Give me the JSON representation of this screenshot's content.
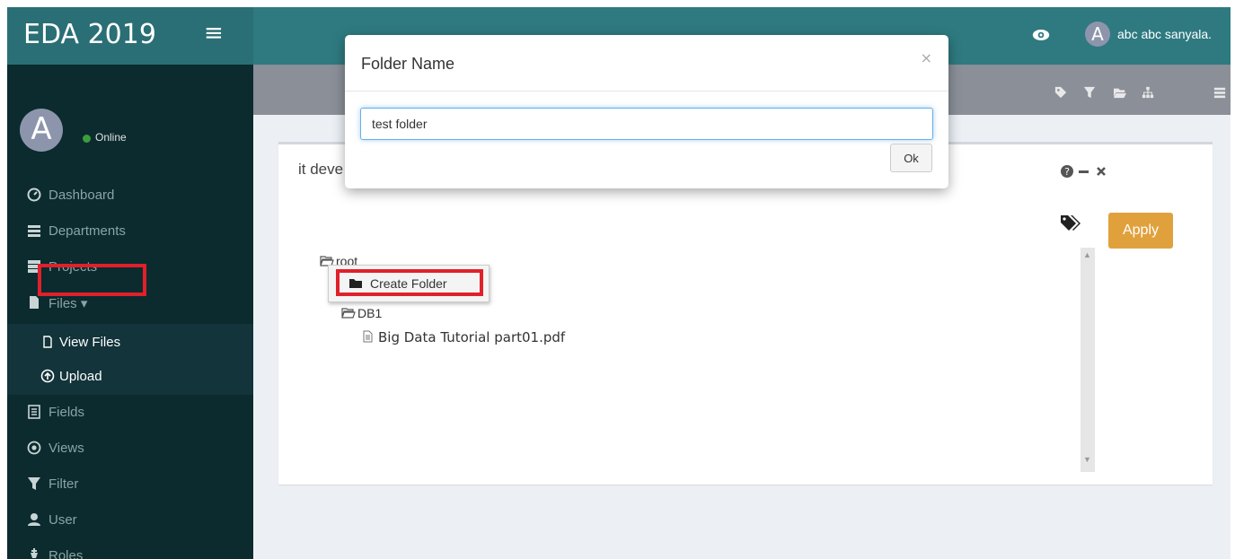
{
  "header": {
    "brand": "EDA 2019",
    "menu_icon": "hamburger-icon",
    "user_avatar_letter": "A",
    "user_name": "abc abc sanyala."
  },
  "sidebar": {
    "avatar_letter": "A",
    "status": "Online",
    "items": [
      {
        "label": "Dashboard",
        "icon": "dashboard-icon"
      },
      {
        "label": "Departments",
        "icon": "list-icon"
      },
      {
        "label": "Projects",
        "icon": "server-icon"
      },
      {
        "label": "Files ▾",
        "icon": "file-icon"
      },
      {
        "label": "View Files",
        "icon": "file-outline-icon"
      },
      {
        "label": "Upload",
        "icon": "upload-icon"
      },
      {
        "label": "Fields",
        "icon": "list-alt-icon"
      },
      {
        "label": "Views",
        "icon": "dot-circle-icon"
      },
      {
        "label": "Filter",
        "icon": "filter-icon"
      },
      {
        "label": "User",
        "icon": "user-icon"
      },
      {
        "label": "Roles",
        "icon": "chess-king-icon"
      }
    ]
  },
  "toolbar": {
    "icons": [
      "tag-icon",
      "filter-icon",
      "folder-open-icon",
      "sitemap-icon",
      "list-icon"
    ]
  },
  "panel": {
    "title": "it deve",
    "tools": "❓ — ✖",
    "apply_label": "Apply"
  },
  "tree": {
    "root_label": "root",
    "context_menu_item": "Create Folder",
    "db1_label": "DB1",
    "file_label": "Big Data Tutorial part01.pdf"
  },
  "modal": {
    "title": "Folder Name",
    "close_label": "×",
    "input_value": "test folder",
    "ok_label": "Ok"
  },
  "colors": {
    "header_bg": "#2e7a80",
    "sidebar_bg": "#0b2b2f",
    "apply_button": "#e0a13d",
    "highlight": "#e0202a"
  }
}
